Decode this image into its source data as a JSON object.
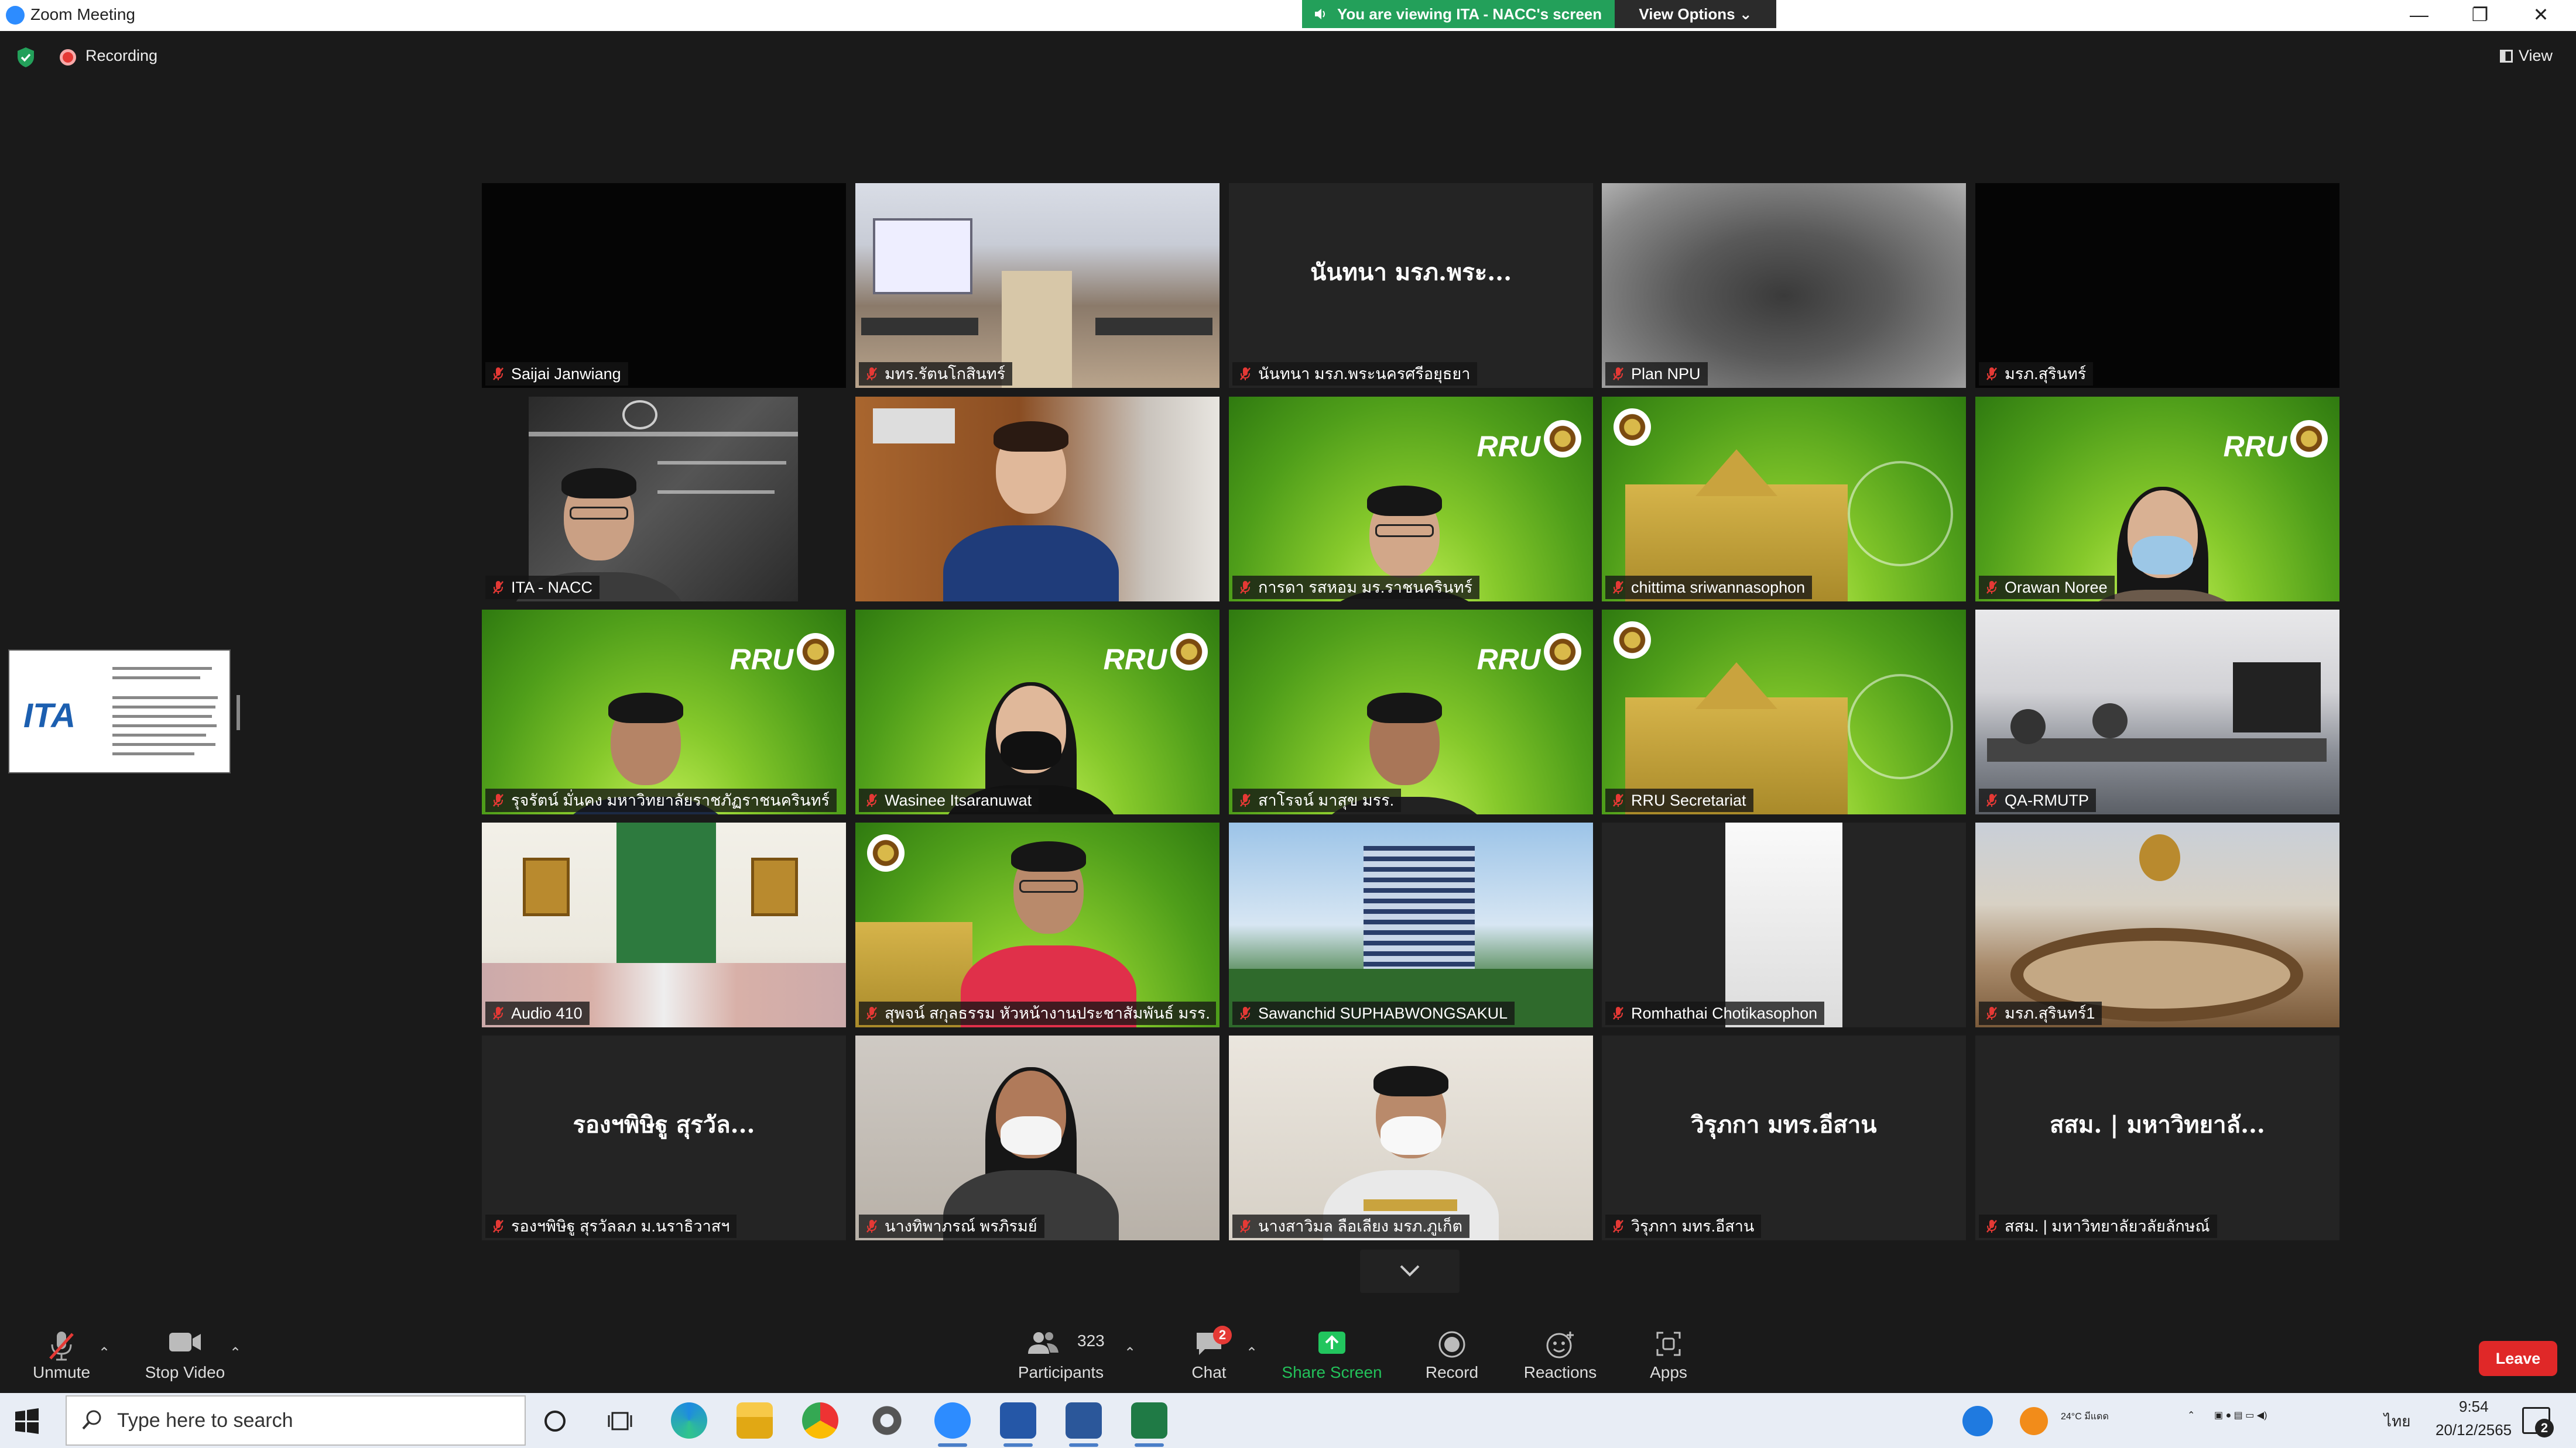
{
  "window": {
    "title": "Zoom Meeting",
    "viewing_banner": "You are viewing ITA - NACC's screen",
    "view_options": "View Options ⌄",
    "controls": {
      "minimize": "—",
      "maximize": "❐",
      "close": "✕"
    }
  },
  "status": {
    "recording_label": "Recording",
    "view_label": "View"
  },
  "colors": {
    "banner_green": "#23a05a",
    "active_speaker": "#e8e86a",
    "leave_red": "#e02828",
    "share_green": "#22c55e"
  },
  "tiles": [
    {
      "name": "Saijai Janwiang",
      "center": "",
      "type": "black"
    },
    {
      "name": "มทร.รัตนโกสินทร์",
      "center": "",
      "type": "room"
    },
    {
      "name": "นันทนา มรภ.พระนครศรีอยุธยา",
      "center": "นันทนา มรภ.พระ...",
      "type": "text"
    },
    {
      "name": "Plan NPU",
      "center": "",
      "type": "blur"
    },
    {
      "name": "มรภ.สุรินทร์",
      "center": "",
      "type": "black"
    },
    {
      "name": "ITA - NACC",
      "center": "",
      "type": "presenter",
      "active": true
    },
    {
      "name": "",
      "center": "",
      "type": "office"
    },
    {
      "name": "การดา รสหอม มร.ราชนครินทร์",
      "center": "",
      "type": "rru-glasses"
    },
    {
      "name": "chittima sriwannasophon",
      "center": "",
      "type": "green-building"
    },
    {
      "name": "Orawan Noree",
      "center": "",
      "type": "rru-mask"
    },
    {
      "name": "รุจรัตน์ มั่นคง มหาวิทยาลัยราชภัฏราชนครินทร์",
      "center": "",
      "type": "rru-man"
    },
    {
      "name": "Wasinee Itsaranuwat",
      "center": "",
      "type": "rru-mask-woman"
    },
    {
      "name": "สาโรจน์ มาสุข มรร.",
      "center": "",
      "type": "rru-man2"
    },
    {
      "name": "RRU Secretariat",
      "center": "",
      "type": "green-building"
    },
    {
      "name": "QA-RMUTP",
      "center": "",
      "type": "meetingroom"
    },
    {
      "name": "Audio 410",
      "center": "",
      "type": "classroom"
    },
    {
      "name": "สุพจน์ สกุลธรรม หัวหน้างานประชาสัมพันธ์ มรร.",
      "center": "",
      "type": "green-redshirt"
    },
    {
      "name": "Sawanchid SUPHABWONGSAKUL",
      "center": "",
      "type": "tower"
    },
    {
      "name": "Romhathai Chotikasophon",
      "center": "",
      "type": "white-panel"
    },
    {
      "name": "มรภ.สุรินทร์1",
      "center": "",
      "type": "roundroom"
    },
    {
      "name": "รองฯพิษิฐู สุรวัลลภ ม.นราธิวาสฯ",
      "center": "รองฯพิษิฐู สุรวัล...",
      "type": "text"
    },
    {
      "name": "นางทิพาภรณ์ พรภิรมย์",
      "center": "",
      "type": "mask-woman"
    },
    {
      "name": "นางสาวิมล ลือเลียง มรภ.ภูเก็ต",
      "center": "",
      "type": "uniform-mask"
    },
    {
      "name": "วิรุภกา มทร.อีสาน",
      "center": "วิรุภกา มทร.อีสาน",
      "type": "text"
    },
    {
      "name": "สสม. | มหาวิทยาลัยวลัยลักษณ์",
      "center": "สสม. | มหาวิทยาลั...",
      "type": "text"
    }
  ],
  "share_thumbnail": {
    "logo": "ITA"
  },
  "toolbar": {
    "unmute": "Unmute",
    "stop_video": "Stop Video",
    "participants": "Participants",
    "participant_count": "323",
    "chat": "Chat",
    "chat_badge": "2",
    "share_screen": "Share Screen",
    "record": "Record",
    "reactions": "Reactions",
    "apps": "Apps",
    "leave": "Leave"
  },
  "taskbar": {
    "search_placeholder": "Type here to search",
    "weather": "24°C มีแดด",
    "language": "ไทย",
    "time": "9:54",
    "date": "20/12/2565",
    "notification_count": "2"
  }
}
